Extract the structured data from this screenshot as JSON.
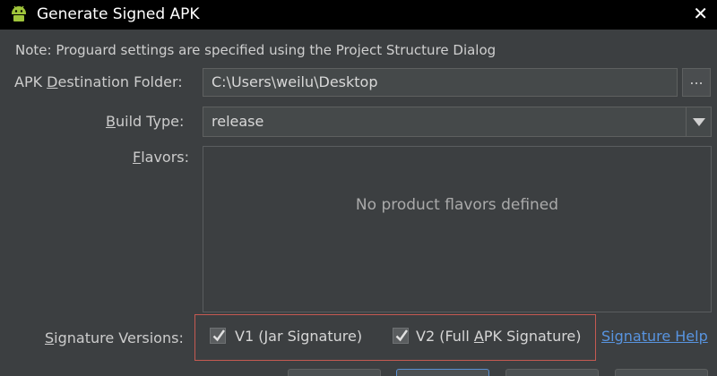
{
  "window": {
    "title": "Generate Signed APK",
    "close_glyph": "✕",
    "app_icon": "android-icon"
  },
  "note": "Note: Proguard settings are specified using the Project Structure Dialog",
  "destination": {
    "label_pre": "APK ",
    "label_mnemonic": "D",
    "label_post": "estination Folder:",
    "value": "C:\\Users\\weilu\\Desktop",
    "browse_label": "..."
  },
  "build_type": {
    "label_mnemonic": "B",
    "label_post": "uild Type:",
    "value": "release"
  },
  "flavors": {
    "label_mnemonic": "F",
    "label_post": "lavors:",
    "empty_text": "No product flavors defined"
  },
  "signature": {
    "label_mnemonic": "S",
    "label_post": "ignature Versions:",
    "v1_label": "V1 (Jar Signature)",
    "v1_checked": true,
    "v2_label_pre": "V2 (Full ",
    "v2_label_mnemonic": "A",
    "v2_label_post": "PK Signature)",
    "v2_checked": true,
    "help_link": "Signature Help"
  },
  "colors": {
    "background": "#3c3f41",
    "titlebar": "#000000",
    "link": "#5894e0",
    "highlight_border": "#c65a52"
  }
}
